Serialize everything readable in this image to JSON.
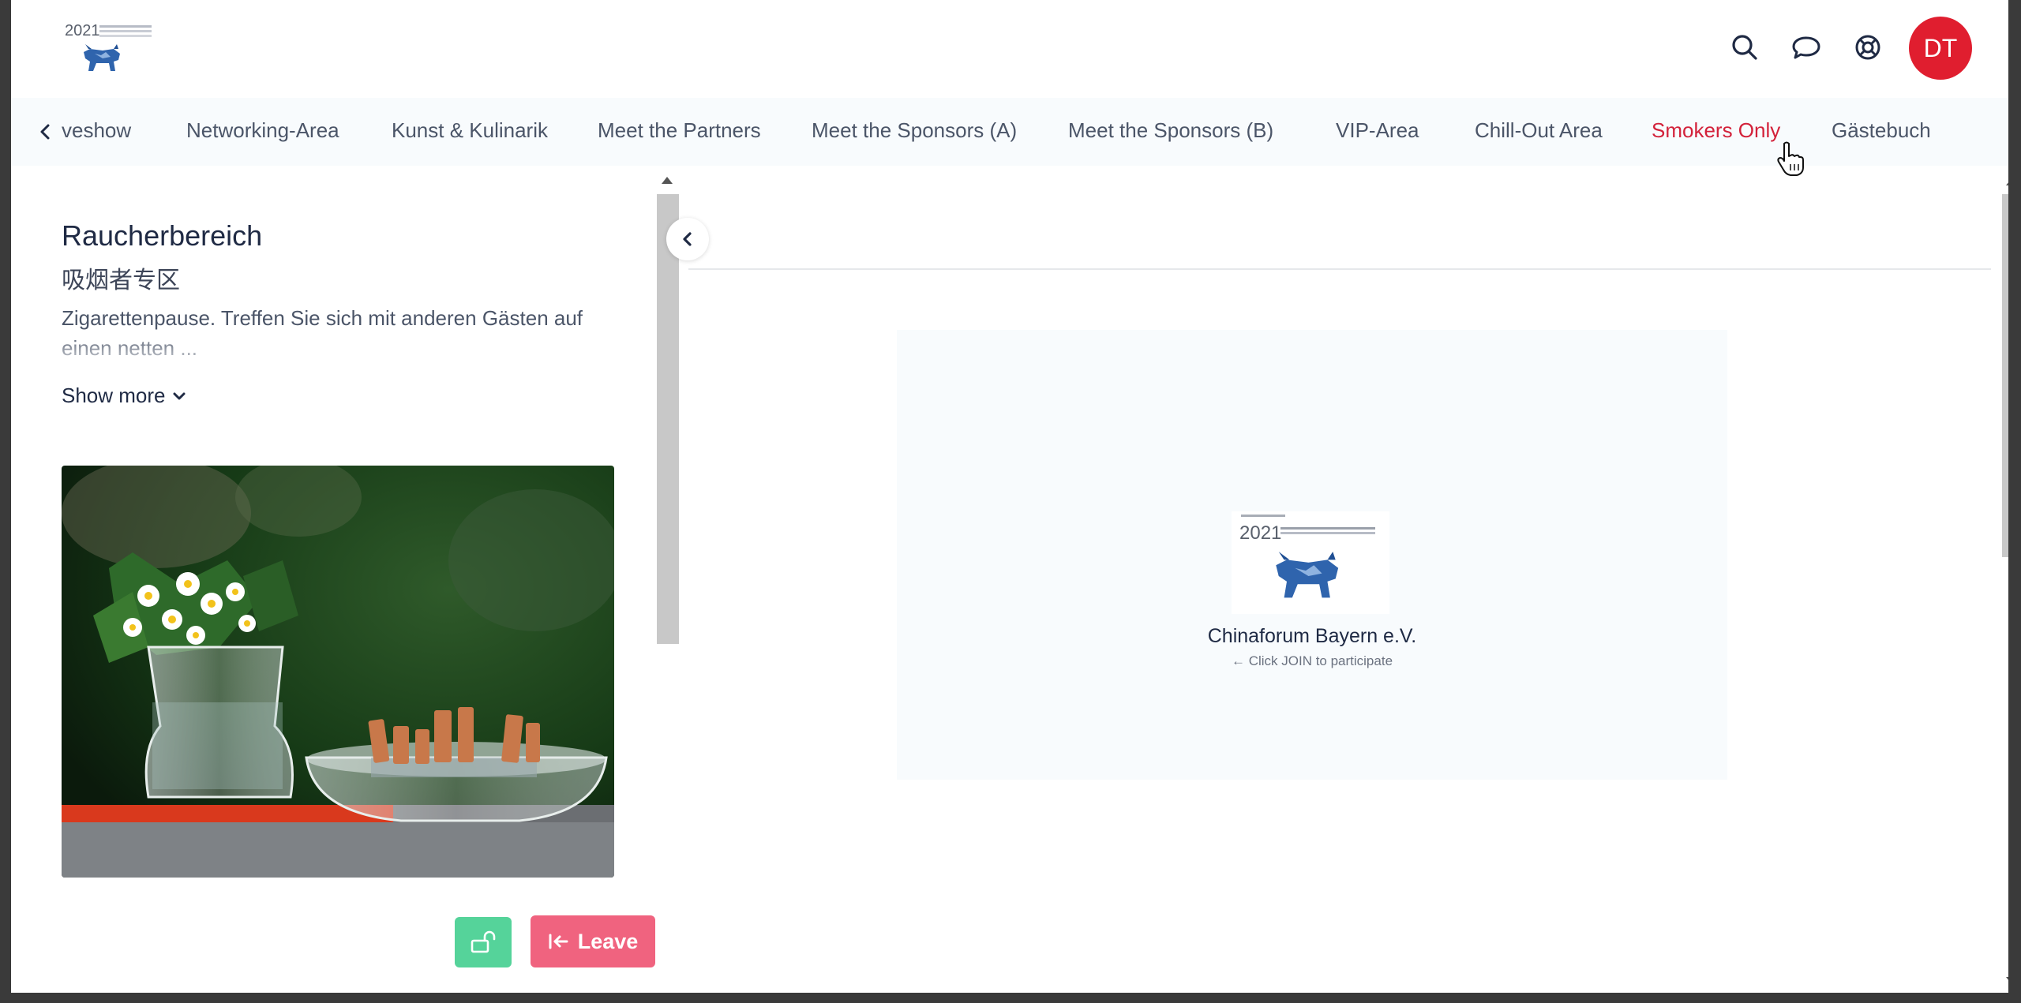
{
  "brand": {
    "logo_year": "2021"
  },
  "header": {
    "avatar_initials": "DT",
    "icons": [
      "search-icon",
      "chat-icon",
      "help-lifebuoy-icon"
    ],
    "avatar_color": "#e01e2f"
  },
  "tabs": {
    "items": [
      {
        "label": "veshow"
      },
      {
        "label": "Networking-Area"
      },
      {
        "label": "Kunst & Kulinarik"
      },
      {
        "label": "Meet the Partners"
      },
      {
        "label": "Meet the Sponsors (A)"
      },
      {
        "label": "Meet the Sponsors (B)"
      },
      {
        "label": "VIP-Area"
      },
      {
        "label": "Chill-Out Area"
      },
      {
        "label": "Smokers Only"
      },
      {
        "label": "Gästebuch"
      }
    ],
    "active": "Smokers Only",
    "active_color": "#d3213a"
  },
  "room": {
    "title": "Raucherbereich",
    "subtitle": "吸烟者专区",
    "description": "Zigarettenpause. Treffen Sie sich mit anderen Gästen auf einen netten ...",
    "show_more": "Show more"
  },
  "actions": {
    "leave_label": "Leave",
    "lock_color": "#55d39a",
    "leave_color": "#f0637f"
  },
  "stage": {
    "logo_year": "2021",
    "org_name": "Chinaforum Bayern e.V.",
    "join_hint": "Click JOIN to participate"
  }
}
